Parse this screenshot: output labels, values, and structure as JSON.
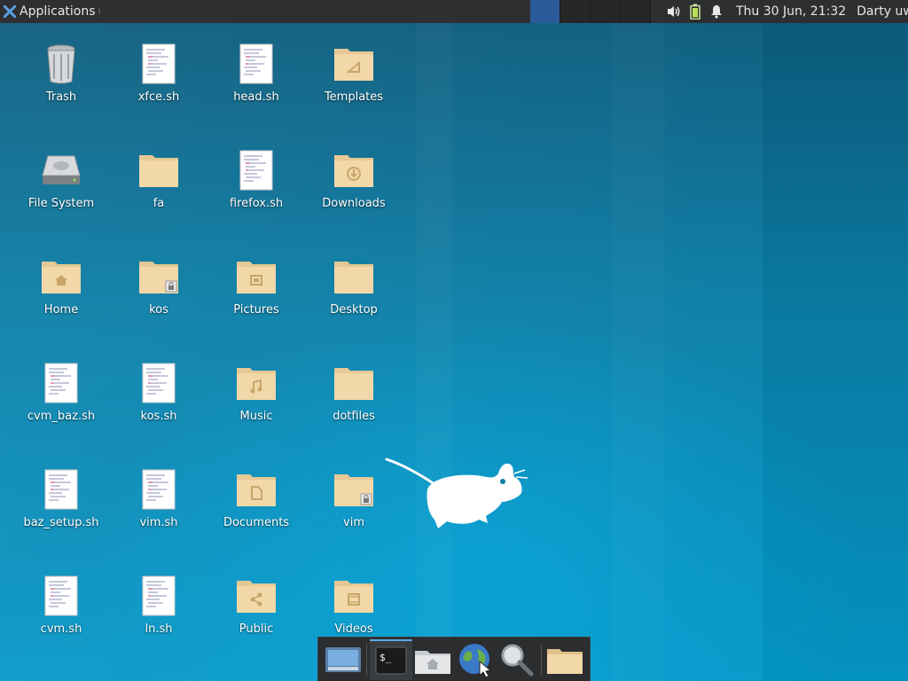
{
  "top_panel": {
    "apps_label": "Applications",
    "apps_menu_glyph": "⁝",
    "clock": "Thu 30 Jun, 21:32",
    "user": "Darty uwu",
    "tray_icons": [
      "volume-icon",
      "battery-icon",
      "notification-bell-icon"
    ]
  },
  "desktop": {
    "icons": [
      {
        "label": "Trash",
        "type": "trash"
      },
      {
        "label": "xfce.sh",
        "type": "script"
      },
      {
        "label": "head.sh",
        "type": "script"
      },
      {
        "label": "Templates",
        "type": "folder-templates"
      },
      {
        "label": "File System",
        "type": "drive"
      },
      {
        "label": "fa",
        "type": "folder"
      },
      {
        "label": "firefox.sh",
        "type": "script"
      },
      {
        "label": "Downloads",
        "type": "folder-downloads"
      },
      {
        "label": "Home",
        "type": "folder-home"
      },
      {
        "label": "kos",
        "type": "folder-locked"
      },
      {
        "label": "Pictures",
        "type": "folder-pictures"
      },
      {
        "label": "Desktop",
        "type": "folder"
      },
      {
        "label": "cvm_baz.sh",
        "type": "script"
      },
      {
        "label": "kos.sh",
        "type": "script"
      },
      {
        "label": "Music",
        "type": "folder-music"
      },
      {
        "label": "dotfiles",
        "type": "folder"
      },
      {
        "label": "baz_setup.sh",
        "type": "script"
      },
      {
        "label": "vim.sh",
        "type": "script"
      },
      {
        "label": "Documents",
        "type": "folder-documents"
      },
      {
        "label": "vim",
        "type": "folder-locked"
      },
      {
        "label": "cvm.sh",
        "type": "script"
      },
      {
        "label": "ln.sh",
        "type": "script"
      },
      {
        "label": "Public",
        "type": "folder-public"
      },
      {
        "label": "Videos",
        "type": "folder-videos"
      }
    ]
  },
  "dock": {
    "items": [
      "show-desktop-icon",
      "terminal-icon",
      "home-folder-icon",
      "web-browser-icon",
      "app-finder-icon",
      "file-manager-icon"
    ],
    "active_item": "terminal-icon"
  },
  "colors": {
    "panel": "#2d2f31",
    "folder": "#f2d8a8",
    "workspace_active": "#2a5a9a"
  }
}
